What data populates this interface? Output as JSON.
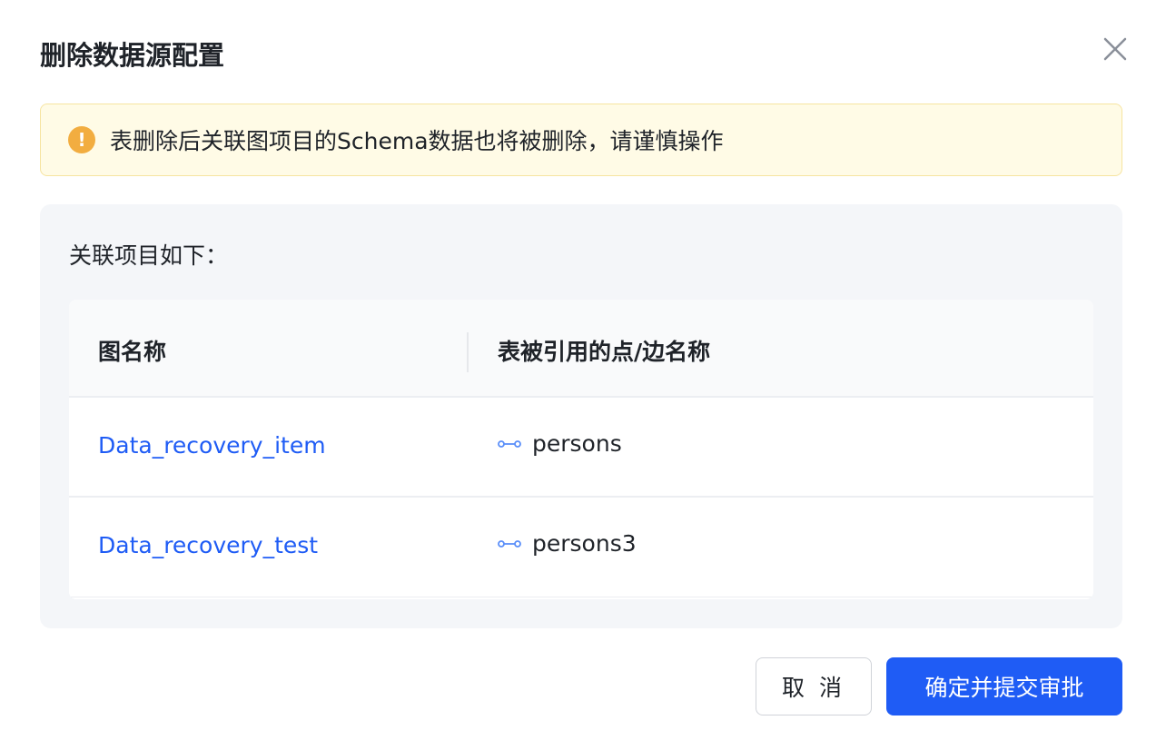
{
  "dialog": {
    "title": "删除数据源配置",
    "close_icon": "close-icon"
  },
  "alert": {
    "icon": "warning-icon",
    "icon_glyph": "!",
    "text": "表删除后关联图项目的Schema数据也将被删除，请谨慎操作",
    "color": "#f2ad40"
  },
  "panel": {
    "label": "关联项目如下："
  },
  "table": {
    "columns": [
      "图名称",
      "表被引用的点/边名称"
    ],
    "rows": [
      {
        "graph_name": "Data_recovery_item",
        "edge_icon": "edge-icon",
        "edge_name": "persons"
      },
      {
        "graph_name": "Data_recovery_test",
        "edge_icon": "edge-icon",
        "edge_name": "persons3"
      }
    ]
  },
  "footer": {
    "cancel_label": "取 消",
    "confirm_label": "确定并提交审批",
    "confirm_color": "#1f5cf5"
  }
}
